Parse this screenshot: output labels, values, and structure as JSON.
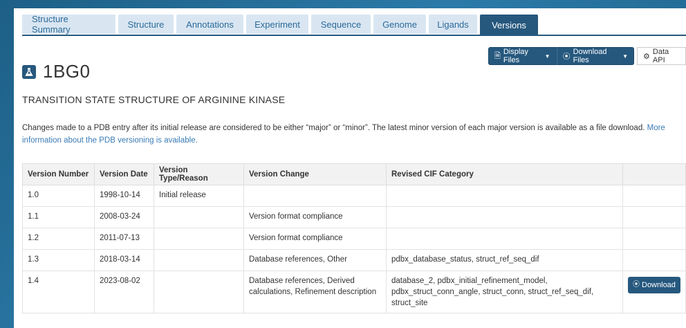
{
  "tabs": [
    {
      "label": "Structure Summary"
    },
    {
      "label": "Structure"
    },
    {
      "label": "Annotations"
    },
    {
      "label": "Experiment"
    },
    {
      "label": "Sequence"
    },
    {
      "label": "Genome"
    },
    {
      "label": "Ligands"
    },
    {
      "label": "Versions",
      "active": true
    }
  ],
  "toolbar": {
    "display_files": "Display Files",
    "download_files": "Download Files",
    "data_api": "Data API"
  },
  "entry": {
    "id": "1BG0",
    "title": "TRANSITION STATE STRUCTURE OF ARGININE KINASE"
  },
  "note": {
    "text": "Changes made to a PDB entry after its initial release are considered to be either “major” or “minor”. The latest minor version of each major version is available as a file download. ",
    "link": "More information about the PDB versioning is available."
  },
  "table": {
    "headers": [
      "Version Number",
      "Version Date",
      "Version Type/Reason",
      "Version Change",
      "Revised CIF Category",
      ""
    ],
    "rows": [
      [
        "1.0",
        "1998-10-14",
        "Initial release",
        "",
        "",
        ""
      ],
      [
        "1.1",
        "2008-03-24",
        "",
        "Version format compliance",
        "",
        ""
      ],
      [
        "1.2",
        "2011-07-13",
        "",
        "Version format compliance",
        "",
        ""
      ],
      [
        "1.3",
        "2018-03-14",
        "",
        "Database references, Other",
        "pdbx_database_status, struct_ref_seq_dif",
        ""
      ],
      [
        "1.4",
        "2023-08-02",
        "",
        "Database references, Derived calculations, Refinement description",
        "database_2, pdbx_initial_refinement_model, pdbx_struct_conn_angle, struct_conn, struct_ref_seq_dif, struct_site",
        "Download"
      ]
    ]
  },
  "colors": {
    "accent": "#26587e",
    "tab_bg": "#d9e6f2",
    "link": "#3a7bb5"
  }
}
